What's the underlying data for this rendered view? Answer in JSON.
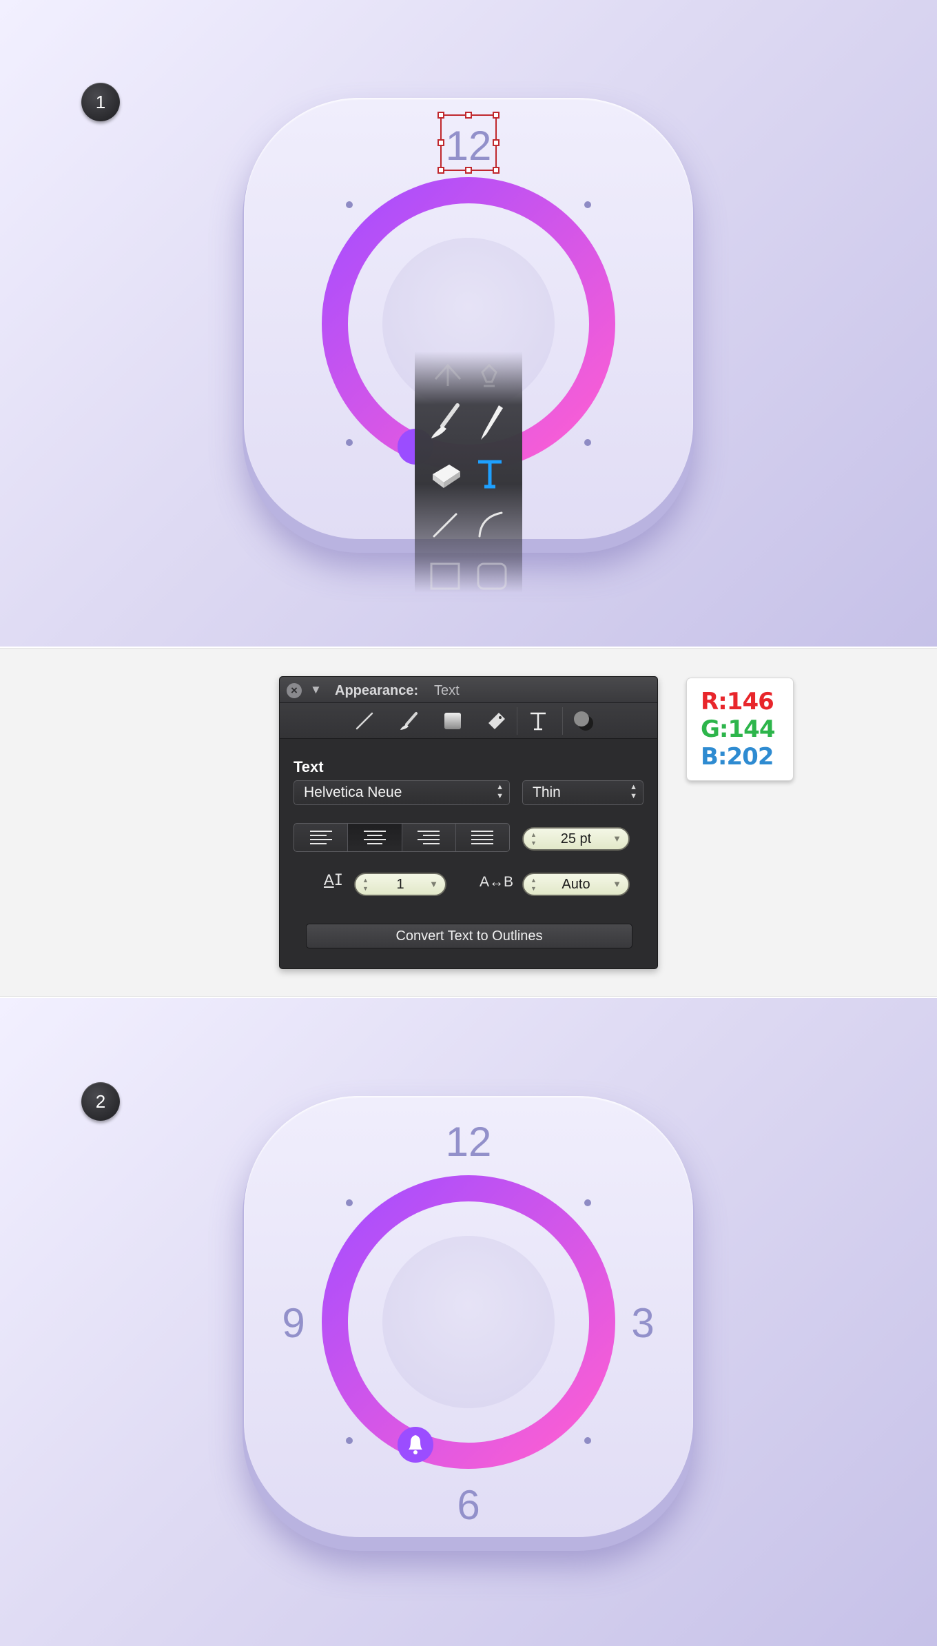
{
  "steps": [
    "1",
    "2"
  ],
  "clock": {
    "numbers_step1": [
      "12"
    ],
    "numbers_step2": [
      "12",
      "3",
      "6",
      "9"
    ],
    "ring_gradient": [
      "#a64dff",
      "#ff5fd2"
    ],
    "number_color": "#9290ca"
  },
  "tool_strip": {
    "tools": [
      "lasso-icon",
      "pen-icon",
      "brush-icon",
      "pencil-icon",
      "eraser-icon",
      "text-tool-icon",
      "line-icon",
      "arc-icon",
      "rectangle-icon",
      "rounded-rectangle-icon"
    ],
    "active_tool": "text-tool-icon",
    "active_color": "#1ea0ff"
  },
  "appearance": {
    "title_label": "Appearance:",
    "title_value": "Text",
    "tabs": [
      "line-tab-icon",
      "brush-tab-icon",
      "fill-tab-icon",
      "tag-tab-icon",
      "text-tab-icon",
      "shadow-tab-icon"
    ],
    "section_label": "Text",
    "font_family": "Helvetica Neue",
    "font_weight": "Thin",
    "alignment": [
      "left",
      "center",
      "right",
      "justify"
    ],
    "alignment_selected": "center",
    "font_size": "25 pt",
    "line_spacing_glyph": "A",
    "line_spacing": "1",
    "char_spacing_glyph": "A↔B",
    "char_spacing": "Auto",
    "convert_button": "Convert Text to Outlines"
  },
  "rgb": {
    "r_label": "R:",
    "r_value": "146",
    "g_label": "G:",
    "g_value": "144",
    "b_label": "B:",
    "b_value": "202",
    "colors": {
      "r": "#e8262b",
      "g": "#2db54b",
      "b": "#2e8bd1"
    }
  }
}
